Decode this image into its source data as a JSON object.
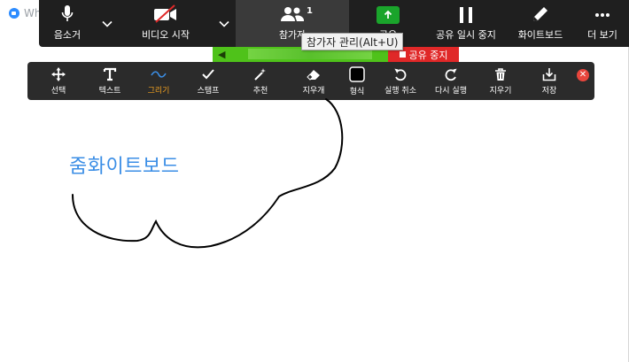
{
  "window": {
    "title_fragment": "Wh"
  },
  "control_bar": {
    "audio_label": "음소거",
    "video_label": "비디오 시작",
    "participants_label": "참가자",
    "participants_count": "1",
    "share_label": "공유",
    "pause_label": "공유 일시 중지",
    "whiteboard_label": "화이트보드",
    "more_label": "더 보기"
  },
  "tooltip": {
    "text": "참가자 관리(Alt+U)"
  },
  "share_indicator": {
    "stop_label": "공유 중지"
  },
  "annotation_toolbar": {
    "tools": [
      {
        "label": "선택",
        "icon": "move-icon"
      },
      {
        "label": "텍스트",
        "icon": "text-icon"
      },
      {
        "label": "그리기",
        "icon": "draw-icon",
        "active": true
      },
      {
        "label": "스탬프",
        "icon": "checkmark-icon"
      },
      {
        "label": "추천",
        "icon": "magic-wand-icon"
      },
      {
        "label": "지우개",
        "icon": "eraser-icon"
      },
      {
        "label": "형식",
        "icon": "format-icon"
      },
      {
        "label": "실행 취소",
        "icon": "undo-icon"
      },
      {
        "label": "다시 실행",
        "icon": "redo-icon"
      },
      {
        "label": "지우기",
        "icon": "trash-icon"
      },
      {
        "label": "저장",
        "icon": "save-icon"
      }
    ]
  },
  "whiteboard": {
    "text": "줌화이트보드"
  },
  "colors": {
    "toolbar_bg": "#1f1f1f",
    "share_green": "#1aa42b",
    "stop_red": "#e02828",
    "active_tool": "#f0a020",
    "whiteboard_text": "#3b8ee6"
  }
}
